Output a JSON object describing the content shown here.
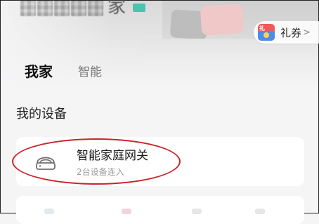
{
  "header": {
    "home_name_visible": "家",
    "coupon": {
      "icon": "gift-voucher-icon",
      "icon_text": "礼",
      "label": "礼券",
      "chevron": "chevron-right-icon"
    }
  },
  "tabs": [
    {
      "label": "我家",
      "active": true
    },
    {
      "label": "智能",
      "active": false
    }
  ],
  "section": {
    "title": "我的设备"
  },
  "devices": [
    {
      "icon": "gateway-icon",
      "name": "智能家庭网关",
      "status": "2台设备连入"
    }
  ],
  "colors": {
    "accent": "#4cc7ba",
    "highlight_annotation": "#c8262b",
    "coupon_red": "#ef5a5a",
    "coupon_blue": "#4a8de8"
  }
}
